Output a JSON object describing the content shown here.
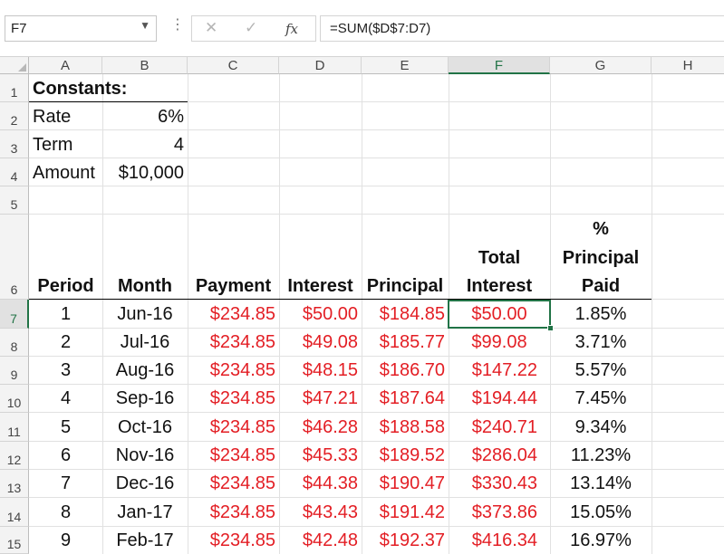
{
  "formula_bar": {
    "name_box": "F7",
    "dots": "⋮",
    "cancel_icon": "✕",
    "enter_icon": "✓",
    "fx_label": "fx",
    "formula": "=SUM($D$7:D7)"
  },
  "columns": [
    "A",
    "B",
    "C",
    "D",
    "E",
    "F",
    "G",
    "H"
  ],
  "rows": [
    "1",
    "2",
    "3",
    "4",
    "5",
    "6",
    "7",
    "8",
    "9",
    "10",
    "11",
    "12",
    "13",
    "14",
    "15"
  ],
  "constants": {
    "title": "Constants:",
    "rate_label": "Rate",
    "rate_value": "6%",
    "term_label": "Term",
    "term_value": "4",
    "amount_label": "Amount",
    "amount_value": "$10,000"
  },
  "headers": {
    "period": "Period",
    "month": "Month",
    "payment": "Payment",
    "interest": "Interest",
    "principal": "Principal",
    "total_interest_1": "Total",
    "total_interest_2": "Interest",
    "pct_1": "%",
    "pct_2": "Principal",
    "pct_3": "Paid"
  },
  "table": [
    {
      "period": "1",
      "month": "Jun-16",
      "payment": "$234.85",
      "interest": "$50.00",
      "principal": "$184.85",
      "total_interest": "$50.00",
      "pct": "1.85%"
    },
    {
      "period": "2",
      "month": "Jul-16",
      "payment": "$234.85",
      "interest": "$49.08",
      "principal": "$185.77",
      "total_interest": "$99.08",
      "pct": "3.71%"
    },
    {
      "period": "3",
      "month": "Aug-16",
      "payment": "$234.85",
      "interest": "$48.15",
      "principal": "$186.70",
      "total_interest": "$147.22",
      "pct": "5.57%"
    },
    {
      "period": "4",
      "month": "Sep-16",
      "payment": "$234.85",
      "interest": "$47.21",
      "principal": "$187.64",
      "total_interest": "$194.44",
      "pct": "7.45%"
    },
    {
      "period": "5",
      "month": "Oct-16",
      "payment": "$234.85",
      "interest": "$46.28",
      "principal": "$188.58",
      "total_interest": "$240.71",
      "pct": "9.34%"
    },
    {
      "period": "6",
      "month": "Nov-16",
      "payment": "$234.85",
      "interest": "$45.33",
      "principal": "$189.52",
      "total_interest": "$286.04",
      "pct": "11.23%"
    },
    {
      "period": "7",
      "month": "Dec-16",
      "payment": "$234.85",
      "interest": "$44.38",
      "principal": "$190.47",
      "total_interest": "$330.43",
      "pct": "13.14%"
    },
    {
      "period": "8",
      "month": "Jan-17",
      "payment": "$234.85",
      "interest": "$43.43",
      "principal": "$191.42",
      "total_interest": "$373.86",
      "pct": "15.05%"
    },
    {
      "period": "9",
      "month": "Feb-17",
      "payment": "$234.85",
      "interest": "$42.48",
      "principal": "$192.37",
      "total_interest": "$416.34",
      "pct": "16.97%"
    }
  ],
  "colors": {
    "accent_green": "#217346",
    "red_text": "#e31e24"
  }
}
